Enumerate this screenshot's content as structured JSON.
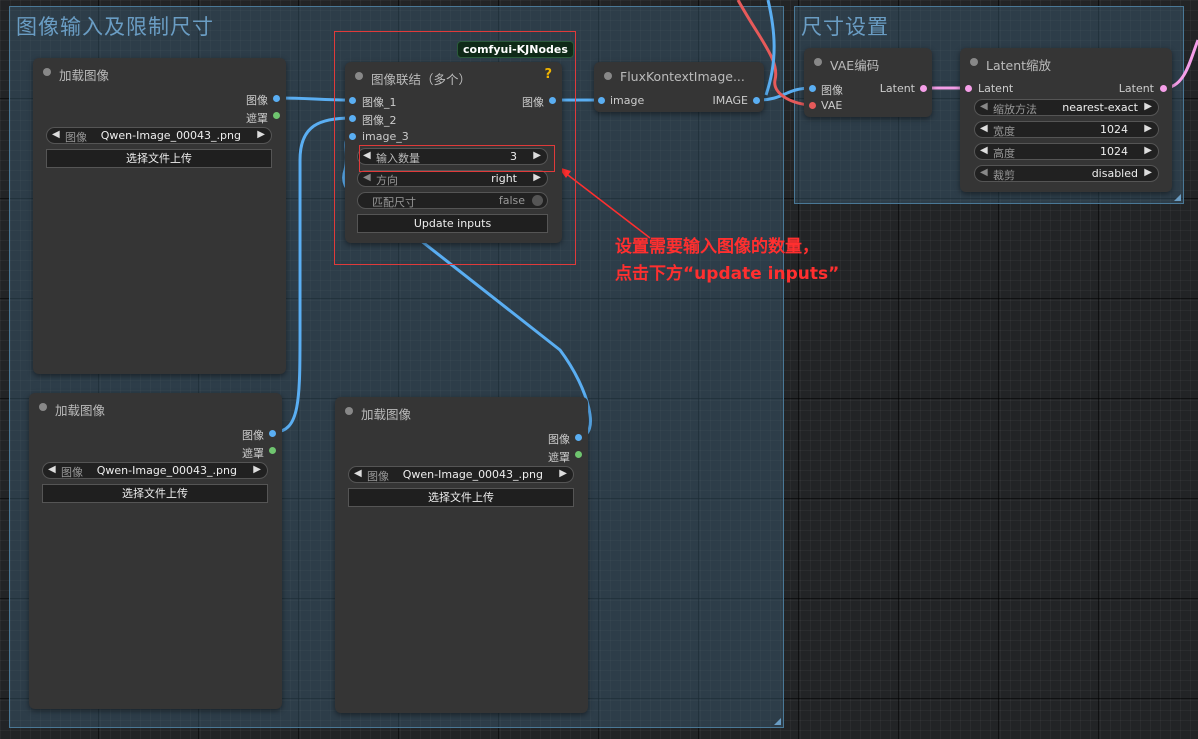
{
  "groups": {
    "input": {
      "title": "图像输入及限制尺寸"
    },
    "size": {
      "title": "尺寸设置"
    }
  },
  "load_node_1": {
    "title": "加载图像",
    "out_image": "图像",
    "out_mask": "遮罩",
    "image_label": "图像",
    "image_value": "Qwen-Image_00043_.png",
    "upload_button": "选择文件上传"
  },
  "load_node_2": {
    "title": "加载图像",
    "out_image": "图像",
    "out_mask": "遮罩",
    "image_label": "图像",
    "image_value": "Qwen-Image_00043_.png",
    "upload_button": "选择文件上传"
  },
  "load_node_3": {
    "title": "加载图像",
    "out_image": "图像",
    "out_mask": "遮罩",
    "image_label": "图像",
    "image_value": "Qwen-Image_00043_.png",
    "upload_button": "选择文件上传"
  },
  "concat_node": {
    "badge": "comfyui-KJNodes",
    "title": "图像联结（多个）",
    "help": "?",
    "in_1": "图像_1",
    "in_2": "图像_2",
    "in_3": "image_3",
    "out_image": "图像",
    "inputcount_label": "输入数量",
    "inputcount_value": "3",
    "direction_label": "方向",
    "direction_value": "right",
    "match_label": "匹配尺寸",
    "match_value": "false",
    "update_button": "Update inputs"
  },
  "flux_node": {
    "title": "FluxKontextImage...",
    "in_image": "image",
    "out_image": "IMAGE"
  },
  "vae_node": {
    "title": "VAE编码",
    "in_image": "图像",
    "in_vae": "VAE",
    "out_latent": "Latent"
  },
  "latent_node": {
    "title": "Latent缩放",
    "in_latent": "Latent",
    "out_latent": "Latent",
    "method_label": "缩放方法",
    "method_value": "nearest-exact",
    "width_label": "宽度",
    "width_value": "1024",
    "height_label": "高度",
    "height_value": "1024",
    "crop_label": "裁剪",
    "crop_value": "disabled"
  },
  "annotation": {
    "line1": "设置需要输入图像的数量，",
    "line2": "点击下方“update inputs”"
  },
  "colors": {
    "image_wire": "#5aaef2",
    "vae_wire": "#e65a5a",
    "latent_wire": "#f59ee8",
    "annotation": "#ff2f2f"
  }
}
